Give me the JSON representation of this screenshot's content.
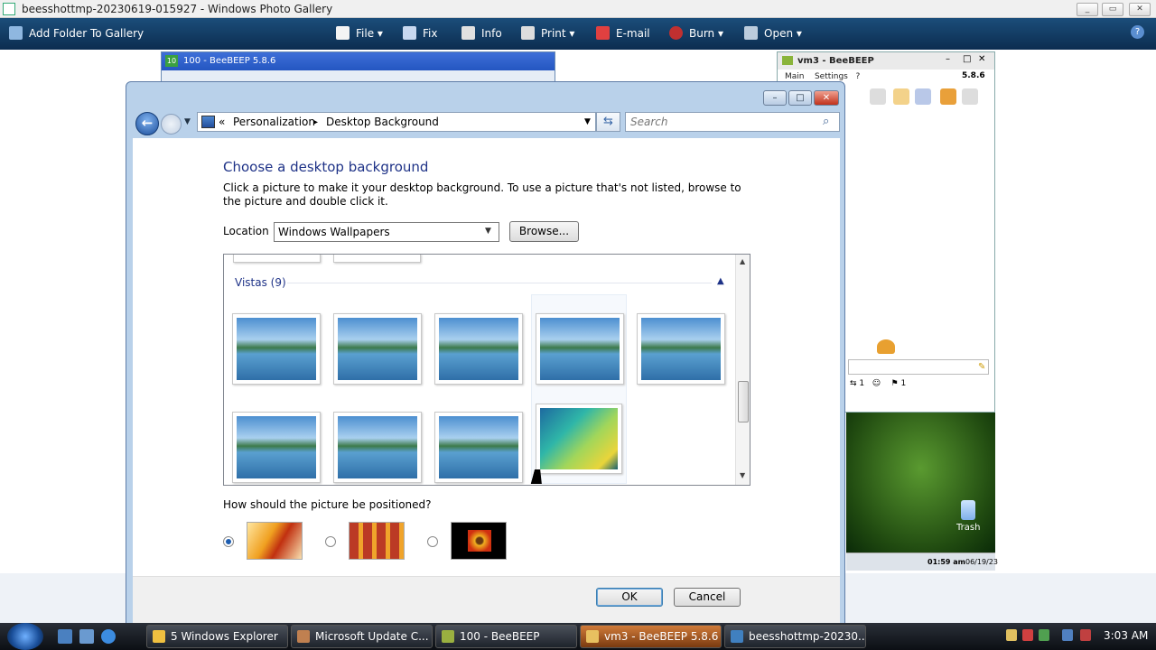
{
  "photo_gallery": {
    "title": "beesshottmp-20230619-015927 - Windows Photo Gallery",
    "toolbar": {
      "add_folder": "Add Folder To Gallery",
      "file": "File",
      "fix": "Fix",
      "info": "Info",
      "print": "Print",
      "email": "E-mail",
      "burn": "Burn",
      "open": "Open"
    }
  },
  "beebeep_window": {
    "title": "100 - BeeBEEP 5.8.6"
  },
  "vm3_window": {
    "title": "vm3 - BeeBEEP",
    "menu_main": "Main",
    "menu_settings": "Settings",
    "menu_help": "?",
    "version": "5.8.6",
    "status_1": "1",
    "status_2": "1"
  },
  "remote_desktop": {
    "trash_label": "Trash",
    "clock": "01:59 am",
    "date": "06/19/23"
  },
  "dialog": {
    "address": {
      "sep": "«",
      "crumb1": "Personalization",
      "arrow": "▸",
      "crumb2": "Desktop Background"
    },
    "search_placeholder": "Search",
    "heading": "Choose a desktop background",
    "description": "Click a picture to make it your desktop background. To use a picture that's not listed, browse to the picture and double click it.",
    "location_label": "Location",
    "location_value": "Windows Wallpapers",
    "browse_label": "Browse...",
    "group_label": "Vistas (9)",
    "position_question": "How should the picture be positioned?",
    "ok_label": "OK",
    "cancel_label": "Cancel"
  },
  "taskbar": {
    "tasks": [
      "5 Windows Explorer",
      "Microsoft Update C...",
      "100 - BeeBEEP",
      "vm3 - BeeBEEP 5.8.6",
      "beesshottmp-20230..."
    ],
    "clock": "3:03 AM"
  },
  "colors": {
    "heading": "#1e3287",
    "toolbar": "#0c2d50",
    "taskbar": "#0c0f14"
  }
}
